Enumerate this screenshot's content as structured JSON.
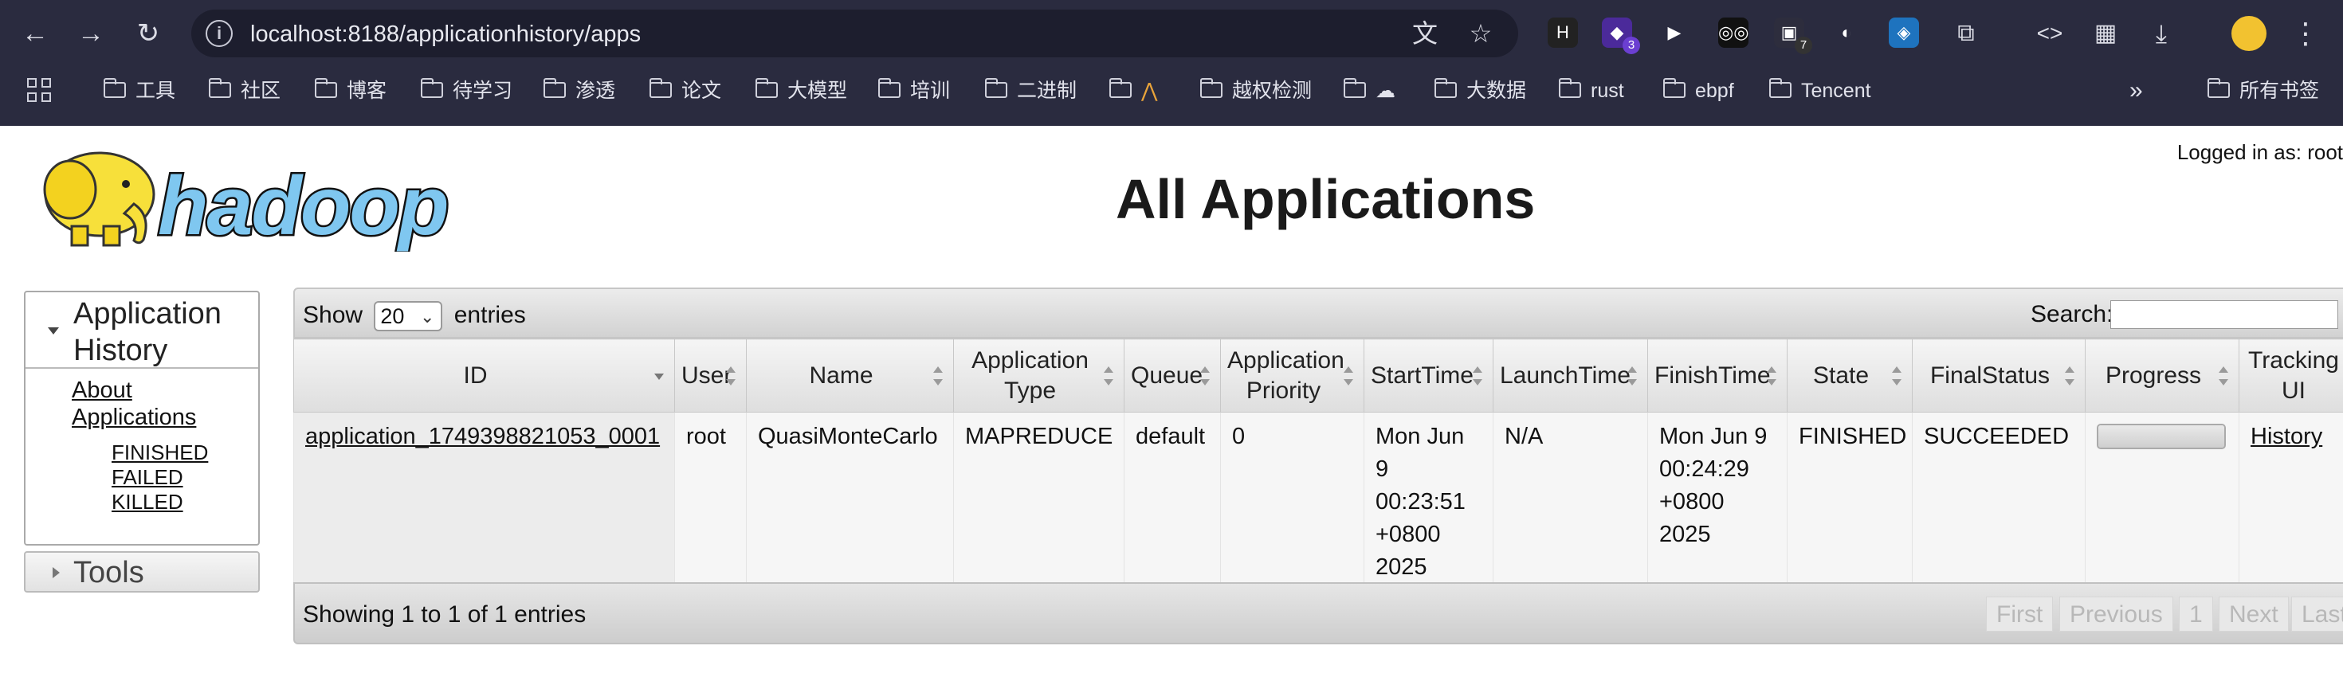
{
  "browser": {
    "url": "localhost:8188/applicationhistory/apps",
    "extensions": [
      {
        "name": "h-extension",
        "glyph": "H",
        "bg": "#222222",
        "badge": ""
      },
      {
        "name": "purple-extension",
        "glyph": "◆",
        "bg": "#4b2a9a",
        "badge": "3"
      },
      {
        "name": "play-extension",
        "glyph": "▶",
        "bg": "transparent",
        "badge": ""
      },
      {
        "name": "glasses-extension",
        "glyph": "◎◎",
        "bg": "#111111",
        "badge": ""
      },
      {
        "name": "box-extension",
        "glyph": "▣",
        "bg": "#2d2d3d",
        "badge": "7"
      },
      {
        "name": "bird-extension",
        "glyph": "◐",
        "bg": "transparent",
        "badge": ""
      },
      {
        "name": "cube-extension",
        "glyph": "◈",
        "bg": "#1e73be",
        "badge": ""
      }
    ],
    "bookmarks": [
      {
        "label": "工具"
      },
      {
        "label": "社区"
      },
      {
        "label": "博客"
      },
      {
        "label": "待学习"
      },
      {
        "label": "渗透"
      },
      {
        "label": "论文"
      },
      {
        "label": "大模型"
      },
      {
        "label": "培训"
      },
      {
        "label": "二进制"
      },
      {
        "label": "⋀"
      },
      {
        "label": "越权检测"
      },
      {
        "label": "☁"
      },
      {
        "label": "大数据"
      },
      {
        "label": "rust"
      },
      {
        "label": "ebpf"
      },
      {
        "label": "Tencent"
      }
    ],
    "more_bookmarks": "»",
    "all_bookmarks": "所有书签"
  },
  "page": {
    "logo_text": "hadoop",
    "title": "All Applications",
    "logged_in": "Logged in as: root"
  },
  "nav": {
    "section_title": "Application History",
    "about_link": "About Applications",
    "sub_links": [
      "FINISHED",
      "FAILED",
      "KILLED"
    ],
    "tools": "Tools"
  },
  "table": {
    "show_label": "Show",
    "page_length": "20",
    "entries_label": "entries",
    "search_label": "Search:",
    "search_value": "",
    "columns": [
      "ID",
      "User",
      "Name",
      "Application Type",
      "Queue",
      "Application Priority",
      "StartTime",
      "LaunchTime",
      "FinishTime",
      "State",
      "FinalStatus",
      "Progress",
      "Tracking UI"
    ],
    "rows": [
      {
        "id": "application_1749398821053_0001",
        "user": "root",
        "name": "QuasiMonteCarlo",
        "type": "MAPREDUCE",
        "queue": "default",
        "priority": "0",
        "start_time": "Mon Jun 9 00:23:51 +0800 2025",
        "launch_time": "N/A",
        "finish_time": "Mon Jun 9 00:24:29 +0800 2025",
        "state": "FINISHED",
        "final_status": "SUCCEEDED",
        "progress": 100,
        "tracking_ui": "History"
      }
    ],
    "info": "Showing 1 to 1 of 1 entries",
    "pager": [
      "First",
      "Previous",
      "1",
      "Next",
      "Last"
    ]
  }
}
